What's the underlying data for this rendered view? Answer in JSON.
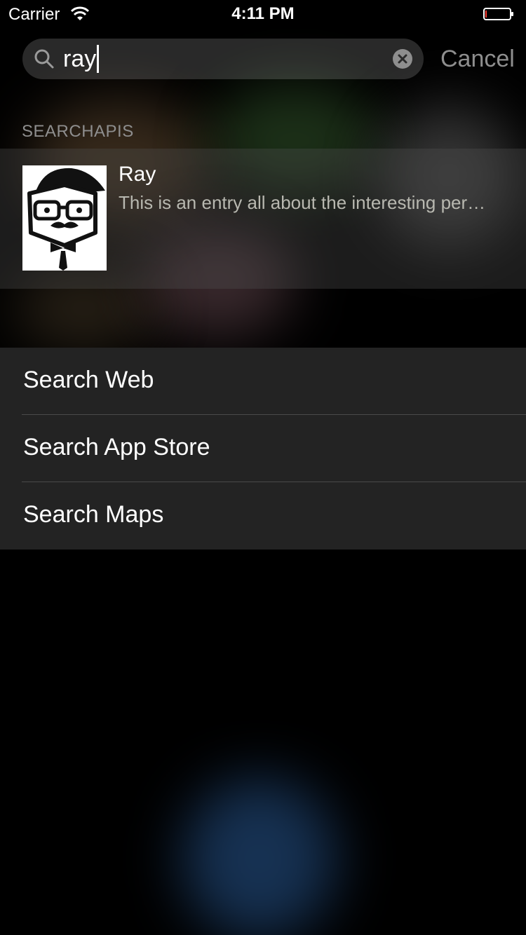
{
  "status_bar": {
    "carrier": "Carrier",
    "time": "4:11 PM",
    "wifi_icon": "wifi-icon",
    "battery_icon": "battery-icon"
  },
  "search": {
    "query": "ray",
    "search_icon": "search-icon",
    "clear_icon": "clear-icon",
    "cancel_label": "Cancel"
  },
  "results": {
    "section_title": "SEARCHAPIS",
    "items": [
      {
        "title": "Ray",
        "subtitle": "This is an entry all about the interesting per…",
        "thumbnail_icon": "mustache-avatar-icon"
      }
    ]
  },
  "actions": [
    {
      "label": "Search Web"
    },
    {
      "label": "Search App Store"
    },
    {
      "label": "Search Maps"
    }
  ],
  "colors": {
    "background": "#000000",
    "field_text": "#ffffff",
    "muted_text": "#8e8e8e",
    "list_background": "#232323"
  }
}
